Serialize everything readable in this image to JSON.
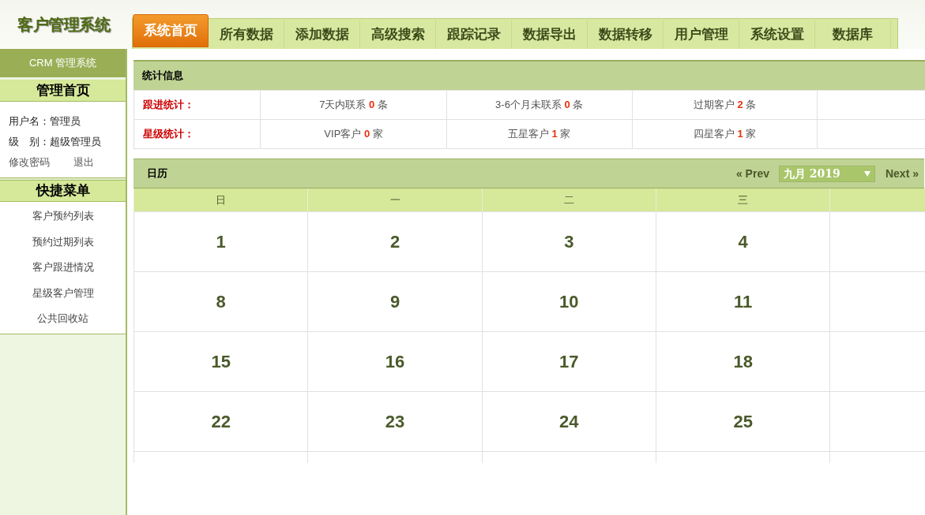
{
  "logo": "客户管理系统",
  "tabs": [
    {
      "label": "系统首页",
      "selected": true
    },
    {
      "label": "所有数据",
      "selected": false
    },
    {
      "label": "添加数据",
      "selected": false
    },
    {
      "label": "高级搜索",
      "selected": false
    },
    {
      "label": "跟踪记录",
      "selected": false
    },
    {
      "label": "数据导出",
      "selected": false
    },
    {
      "label": "数据转移",
      "selected": false
    },
    {
      "label": "用户管理",
      "selected": false
    },
    {
      "label": "系统设置",
      "selected": false
    },
    {
      "label": "数据库",
      "selected": false
    }
  ],
  "sidebar": {
    "brand": "CRM 管理系统",
    "home_title": "管理首页",
    "user": [
      {
        "label": "用户名：",
        "value": "管理员"
      },
      {
        "label": "级　别：",
        "value": "超级管理员"
      }
    ],
    "links": [
      "修改密码",
      "退出"
    ],
    "menu_title": "快捷菜单",
    "menu": [
      "客户预约列表",
      "预约过期列表",
      "客户跟进情况",
      "星级客户管理",
      "公共回收站"
    ]
  },
  "stats": {
    "title": "统计信息",
    "rows": [
      {
        "label": "跟进统计：",
        "cells": [
          {
            "prefix": "7天内联系",
            "count": "0",
            "unit": "条"
          },
          {
            "prefix": "3-6个月未联系",
            "count": "0",
            "unit": "条"
          },
          {
            "prefix": "过期客户",
            "count": "2",
            "unit": "条"
          }
        ]
      },
      {
        "label": "星级统计：",
        "cells": [
          {
            "prefix": "VIP客户",
            "count": "0",
            "unit": "家"
          },
          {
            "prefix": "五星客户",
            "count": "1",
            "unit": "家"
          },
          {
            "prefix": "四星客户",
            "count": "1",
            "unit": "家"
          }
        ]
      }
    ]
  },
  "calendar": {
    "title": "日历",
    "prev": "« Prev",
    "month": "九月 2019",
    "next": "Next »",
    "weekdays": [
      "日",
      "一",
      "二",
      "三"
    ],
    "weeks": [
      [
        "1",
        "2",
        "3",
        "4"
      ],
      [
        "8",
        "9",
        "10",
        "11"
      ],
      [
        "15",
        "16",
        "17",
        "18"
      ],
      [
        "22",
        "23",
        "24",
        "25"
      ]
    ]
  }
}
